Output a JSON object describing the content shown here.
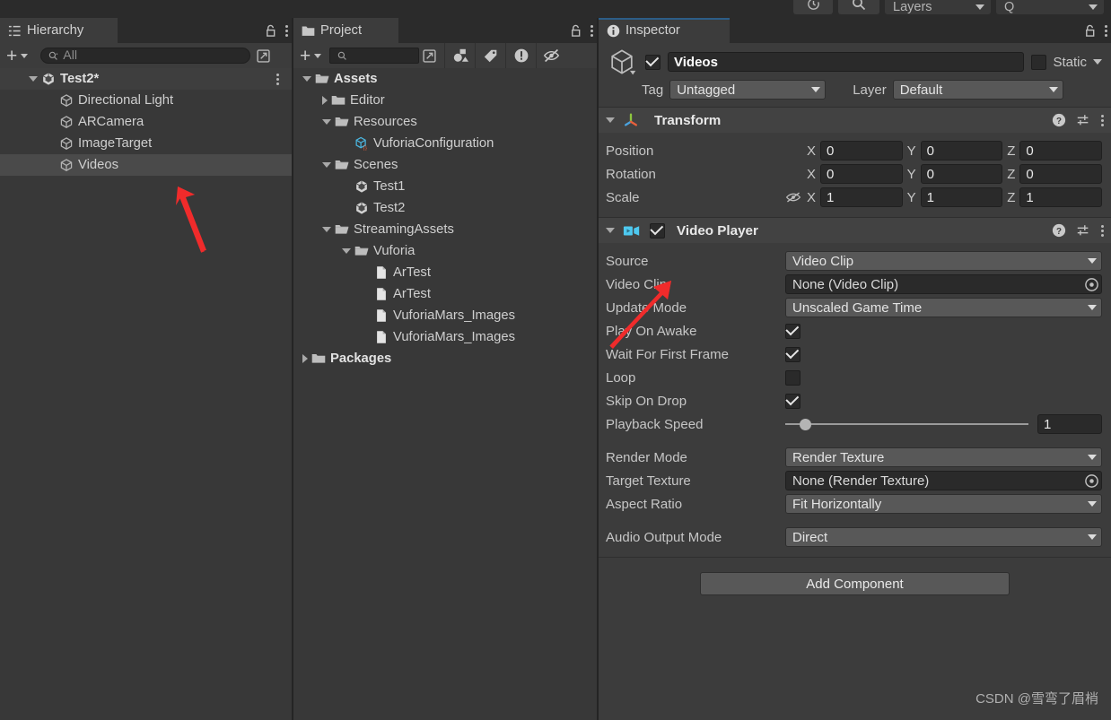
{
  "toolbar": {
    "history_icon": "history-icon",
    "search_icon": "search-icon",
    "layers_label": "Layers",
    "layout_value": "Q"
  },
  "hierarchy": {
    "tab_label": "Hierarchy",
    "tab_icon": "hierarchy-icon",
    "create_label": "+",
    "search_placeholder": "All",
    "search_value": "",
    "scene": {
      "label": "Test2*",
      "icon": "unity-scene-icon"
    },
    "items": [
      {
        "label": "Directional Light",
        "icon": "gameobject-icon",
        "selected": false
      },
      {
        "label": "ARCamera",
        "icon": "gameobject-icon",
        "selected": false
      },
      {
        "label": "ImageTarget",
        "icon": "gameobject-icon",
        "selected": false
      },
      {
        "label": "Videos",
        "icon": "gameobject-icon",
        "selected": true
      }
    ]
  },
  "project": {
    "tab_label": "Project",
    "tab_icon": "folder-icon",
    "create_label": "+",
    "search_placeholder": "",
    "search_value": "",
    "filter_icons": [
      "type-filter-icon",
      "label-filter-icon",
      "warning-filter-icon",
      "hidden-filter-icon"
    ],
    "tree": [
      {
        "label": "Assets",
        "indent": 0,
        "arrow": "down",
        "icon": "folder-open-icon",
        "bold": true
      },
      {
        "label": "Editor",
        "indent": 1,
        "arrow": "right",
        "icon": "folder-icon",
        "bold": false
      },
      {
        "label": "Resources",
        "indent": 1,
        "arrow": "down",
        "icon": "folder-open-icon",
        "bold": false
      },
      {
        "label": "VuforiaConfiguration",
        "indent": 2,
        "arrow": "none",
        "icon": "scriptable-object-icon",
        "bold": false
      },
      {
        "label": "Scenes",
        "indent": 1,
        "arrow": "down",
        "icon": "folder-open-icon",
        "bold": false
      },
      {
        "label": "Test1",
        "indent": 2,
        "arrow": "none",
        "icon": "unity-scene-icon",
        "bold": false
      },
      {
        "label": "Test2",
        "indent": 2,
        "arrow": "none",
        "icon": "unity-scene-icon",
        "bold": false
      },
      {
        "label": "StreamingAssets",
        "indent": 1,
        "arrow": "down",
        "icon": "folder-open-icon",
        "bold": false
      },
      {
        "label": "Vuforia",
        "indent": 2,
        "arrow": "down",
        "icon": "folder-open-icon",
        "bold": false
      },
      {
        "label": "ArTest",
        "indent": 3,
        "arrow": "none",
        "icon": "file-icon",
        "bold": false
      },
      {
        "label": "ArTest",
        "indent": 3,
        "arrow": "none",
        "icon": "file-icon",
        "bold": false
      },
      {
        "label": "VuforiaMars_Images",
        "indent": 3,
        "arrow": "none",
        "icon": "file-icon",
        "bold": false
      },
      {
        "label": "VuforiaMars_Images",
        "indent": 3,
        "arrow": "none",
        "icon": "file-icon",
        "bold": false
      },
      {
        "label": "Packages",
        "indent": 0,
        "arrow": "right",
        "icon": "folder-icon",
        "bold": true
      }
    ]
  },
  "inspector": {
    "tab_label": "Inspector",
    "tab_icon": "info-icon",
    "object": {
      "enabled": true,
      "name": "Videos",
      "static_label": "Static",
      "static_checked": false,
      "tag_label": "Tag",
      "tag_value": "Untagged",
      "layer_label": "Layer",
      "layer_value": "Default"
    },
    "transform": {
      "title": "Transform",
      "icon": "transform-gizmo-icon",
      "expanded": true,
      "rows": [
        {
          "label": "Position",
          "x": "0",
          "y": "0",
          "z": "0",
          "eye": false
        },
        {
          "label": "Rotation",
          "x": "0",
          "y": "0",
          "z": "0",
          "eye": false
        },
        {
          "label": "Scale",
          "x": "1",
          "y": "1",
          "z": "1",
          "eye": true
        }
      ],
      "axis_labels": [
        "X",
        "Y",
        "Z"
      ]
    },
    "video_player": {
      "title": "Video Player",
      "icon": "video-player-icon",
      "enabled": true,
      "expanded": true,
      "props": [
        {
          "label": "Source",
          "kind": "dropdown",
          "value": "Video Clip"
        },
        {
          "label": "Video Clip",
          "kind": "object",
          "value": "None (Video Clip)"
        },
        {
          "label": "Update Mode",
          "kind": "dropdown",
          "value": "Unscaled Game Time"
        },
        {
          "label": "Play On Awake",
          "kind": "checkbox",
          "value": true
        },
        {
          "label": "Wait For First Frame",
          "kind": "checkbox",
          "value": true
        },
        {
          "label": "Loop",
          "kind": "checkbox",
          "value": false
        },
        {
          "label": "Skip On Drop",
          "kind": "checkbox",
          "value": true
        },
        {
          "label": "Playback Speed",
          "kind": "slider",
          "value": "1"
        },
        {
          "label": "",
          "kind": "spacer",
          "value": ""
        },
        {
          "label": "Render Mode",
          "kind": "dropdown",
          "value": "Render Texture"
        },
        {
          "label": "Target Texture",
          "kind": "object",
          "value": "None (Render Texture)"
        },
        {
          "label": "Aspect Ratio",
          "kind": "dropdown",
          "value": "Fit Horizontally"
        },
        {
          "label": "",
          "kind": "spacer",
          "value": ""
        },
        {
          "label": "Audio Output Mode",
          "kind": "dropdown",
          "value": "Direct"
        }
      ]
    },
    "add_component_label": "Add Component",
    "watermark": "CSDN @雪弯了眉梢"
  },
  "colors": {
    "panel_bg": "#383838",
    "body_bg": "#3c3c3c",
    "header_bg": "#424242",
    "tabstrip_bg": "#2b2b2b",
    "field_bg": "#2a2a2a",
    "dropdown_bg": "#585858",
    "selection": "#4a4a4a",
    "accent_blue": "#2c5d87",
    "annotation_red": "#f02b2b",
    "text": "#c4c4c4"
  }
}
